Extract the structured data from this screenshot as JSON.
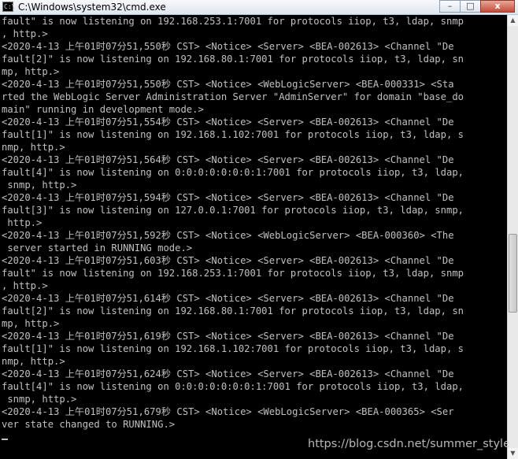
{
  "window": {
    "title": "C:\\Windows\\system32\\cmd.exe",
    "icon_text": "C:\\",
    "controls": {
      "minimize": "–",
      "maximize": "□",
      "close": "x"
    }
  },
  "console": {
    "lines": [
      "fault\" is now listening on 192.168.253.1:7001 for protocols iiop, t3, ldap, snmp",
      ", http.>",
      "<2020-4-13 上午01时07分51,550秒 CST> <Notice> <Server> <BEA-002613> <Channel \"De",
      "fault[2]\" is now listening on 192.168.80.1:7001 for protocols iiop, t3, ldap, sn",
      "mp, http.>",
      "<2020-4-13 上午01时07分51,550秒 CST> <Notice> <WebLogicServer> <BEA-000331> <Sta",
      "rted the WebLogic Server Administration Server \"AdminServer\" for domain \"base_do",
      "main\" running in development mode.>",
      "<2020-4-13 上午01时07分51,554秒 CST> <Notice> <Server> <BEA-002613> <Channel \"De",
      "fault[1]\" is now listening on 192.168.1.102:7001 for protocols iiop, t3, ldap, s",
      "nmp, http.>",
      "<2020-4-13 上午01时07分51,564秒 CST> <Notice> <Server> <BEA-002613> <Channel \"De",
      "fault[4]\" is now listening on 0:0:0:0:0:0:0:1:7001 for protocols iiop, t3, ldap,",
      " snmp, http.>",
      "<2020-4-13 上午01时07分51,594秒 CST> <Notice> <Server> <BEA-002613> <Channel \"De",
      "fault[3]\" is now listening on 127.0.0.1:7001 for protocols iiop, t3, ldap, snmp,",
      " http.>",
      "<2020-4-13 上午01时07分51,592秒 CST> <Notice> <WebLogicServer> <BEA-000360> <The",
      " server started in RUNNING mode.>",
      "<2020-4-13 上午01时07分51,603秒 CST> <Notice> <Server> <BEA-002613> <Channel \"De",
      "fault\" is now listening on 192.168.253.1:7001 for protocols iiop, t3, ldap, snmp",
      ", http.>",
      "<2020-4-13 上午01时07分51,614秒 CST> <Notice> <Server> <BEA-002613> <Channel \"De",
      "fault[2]\" is now listening on 192.168.80.1:7001 for protocols iiop, t3, ldap, sn",
      "mp, http.>",
      "<2020-4-13 上午01时07分51,619秒 CST> <Notice> <Server> <BEA-002613> <Channel \"De",
      "fault[1]\" is now listening on 192.168.1.102:7001 for protocols iiop, t3, ldap, s",
      "nmp, http.>",
      "<2020-4-13 上午01时07分51,624秒 CST> <Notice> <Server> <BEA-002613> <Channel \"De",
      "fault[4]\" is now listening on 0:0:0:0:0:0:0:1:7001 for protocols iiop, t3, ldap,",
      " snmp, http.>",
      "<2020-4-13 上午01时07分51,679秒 CST> <Notice> <WebLogicServer> <BEA-000365> <Ser",
      "ver state changed to RUNNING.>"
    ]
  },
  "scrollbar": {
    "up_arrow": "▲",
    "down_arrow": "▼"
  },
  "watermark": "https://blog.csdn.net/summer_style"
}
